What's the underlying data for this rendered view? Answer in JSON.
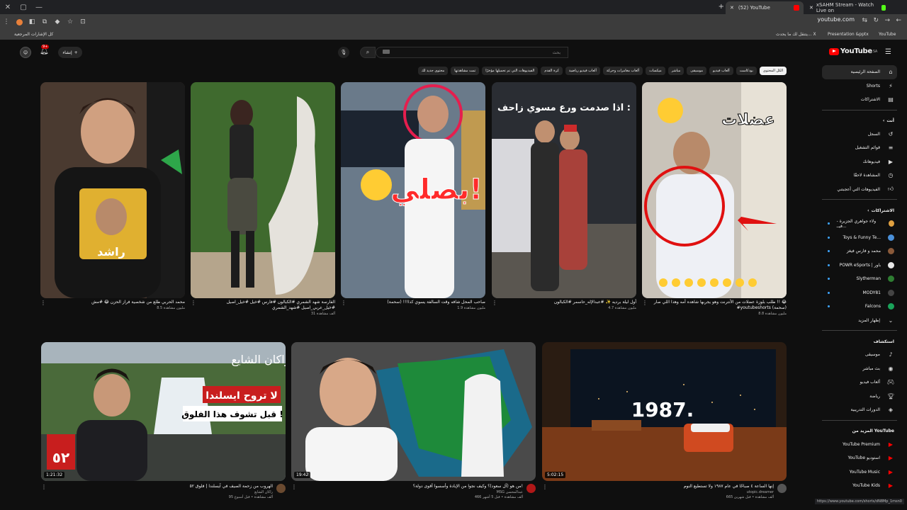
{
  "browser": {
    "tabs": [
      {
        "label": "(52) YouTube",
        "active": true
      },
      {
        "label": "xSAHM Stream - Watch Live on",
        "active": false
      }
    ],
    "url": "youtube.com",
    "bookmarks": [
      "كل الإشارات المرجعية",
      "يتنقل لك ما يحدث... X",
      "Presentation &pptx",
      "YouTube"
    ],
    "status_url": "https://www.youtube.com/shorts/dN8Mp_1msn0"
  },
  "header": {
    "logo": "YouTube",
    "region": "SA",
    "search_placeholder": "بحث",
    "create_label": "إنشاء",
    "notifications": "9+"
  },
  "chips": [
    {
      "label": "الكل المحتوى",
      "active": true
    },
    {
      "label": "بودكاست"
    },
    {
      "label": "ألعاب فيديو"
    },
    {
      "label": "موسيقى"
    },
    {
      "label": "مباشر"
    },
    {
      "label": "ميكسات"
    },
    {
      "label": "ألعاب مغامرات وحركة"
    },
    {
      "label": "ألعاب فيديو رياضية"
    },
    {
      "label": "كرة القدم"
    },
    {
      "label": "الفيديوهات التي تم تحميلها مؤخرًا"
    },
    {
      "label": "تمت مشاهدتها"
    },
    {
      "label": "محتوى جديد لك"
    }
  ],
  "shorts": [
    {
      "title": "طلب بلوزة عضلات من الأنترنت وهو يجربها شاهده أمه وهذا اللي صار !! 😂 #youtubeshorts (سحمة)",
      "views": "8.8 مليون مشاهدة"
    },
    {
      "title": "أول ليلة برديه ✨ #عبدالإله_حاسمر #الكبالون",
      "views": "4.7 مليون مشاهدة"
    },
    {
      "title": "صاحب المحل شافه وقت السالفة يسوي كذا!!! (سحمة)",
      "views": "1.9 مليون مشاهدة"
    },
    {
      "title": "الفارسة شهد الشمري #الكبالون #فارس #خيل #خيل_اصيل #خيل_عربي_اصيل #شهد_الشمري",
      "views": "31 ألف مشاهدة"
    },
    {
      "title": "محمد الحربي طلع من شخصية فراز الحزن 😂 #مش",
      "views": "8.5 مليون مشاهدة"
    }
  ],
  "videos": [
    {
      "title": "إنها الساعة ٤ صباحًا في عام ١٩٨٧ ولا تستطيع النوم",
      "channel": "utopic.dreamer",
      "stats": "665 ألف مشاهدة • قبل شهرين",
      "duration": "5:02:15"
    },
    {
      "title": "من هو (آل سعود)؟ وكيف نجوا من الإبادة وأسسوا أقوى دولة؟!",
      "channel": "MSG عبدالمحسن",
      "stats": "466 ألف مشاهدة • قبل 5 أشهر",
      "duration": "19:42"
    },
    {
      "title": "الهروب من زحمة الصيف في آيسلندا | فلوق ٥٢",
      "channel": "راكان الشايع",
      "stats": "95 ألف مشاهدة • قبل أسبوع",
      "duration": "1:21:32"
    }
  ],
  "sidebar": {
    "main": [
      {
        "label": "الصفحة الرئيسية",
        "icon": "home-icon",
        "active": true
      },
      {
        "label": "Shorts",
        "icon": "shorts-icon"
      },
      {
        "label": "الاشتراكات",
        "icon": "subscriptions-icon"
      }
    ],
    "you_heading": "أنت",
    "you": [
      {
        "label": "السجل",
        "icon": "history-icon"
      },
      {
        "label": "قوائم التشغيل",
        "icon": "playlist-icon"
      },
      {
        "label": "فيديوهاتك",
        "icon": "your-videos-icon"
      },
      {
        "label": "المشاهدة لاحقًا",
        "icon": "watch-later-icon"
      },
      {
        "label": "الفيديوهات التي أعجبتني",
        "icon": "like-icon"
      }
    ],
    "subs_heading": "الاشتراكات",
    "subs": [
      {
        "label": "ولاء جواهري الجزيرة - فيــ...",
        "color": "#e0a040"
      },
      {
        "label": "Toys & Funny Te...",
        "color": "#4a90d9"
      },
      {
        "label": "محمد و فارس فيغز",
        "color": "#8a5a3a"
      },
      {
        "label": "POWR eSports | باور",
        "color": "#e8e8e8"
      },
      {
        "label": "Slytherman",
        "color": "#2e7d32"
      },
      {
        "label": "MODY81",
        "color": "#444"
      },
      {
        "label": "Falcons",
        "color": "#1aa35a"
      }
    ],
    "show_more": "إظهار المزيد",
    "explore_heading": "استكشاف",
    "explore": [
      {
        "label": "موسيقى",
        "icon": "music-icon"
      },
      {
        "label": "بث مباشر",
        "icon": "live-icon"
      },
      {
        "label": "ألعاب فيديو",
        "icon": "gaming-icon"
      },
      {
        "label": "رياضة",
        "icon": "trophy-icon"
      },
      {
        "label": "الدورات التدريبية",
        "icon": "courses-icon"
      }
    ],
    "more_heading": "المزيد من YouTube",
    "more": [
      {
        "label": "YouTube Premium"
      },
      {
        "label": "YouTube استوديو"
      },
      {
        "label": "YouTube Music"
      },
      {
        "label": "YouTube Kids"
      }
    ]
  }
}
